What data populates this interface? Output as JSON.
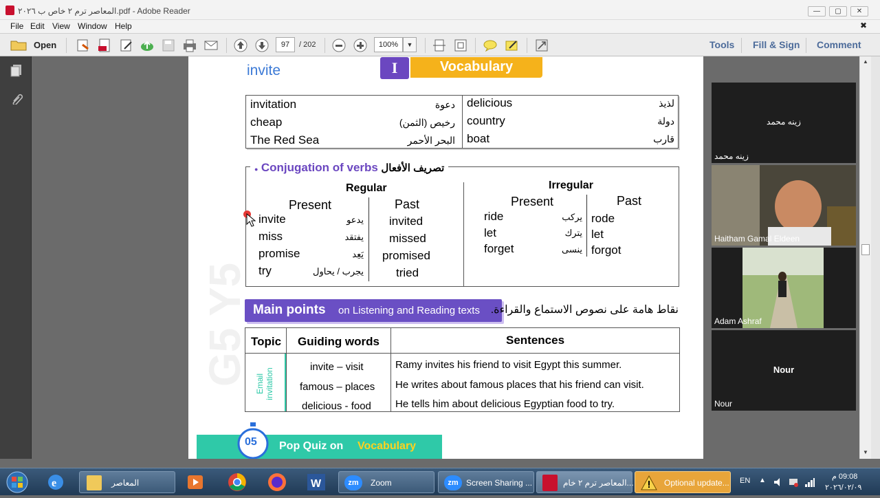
{
  "window": {
    "title": "المعاصر ترم ٢ خاص ب ٢٠٢٦.pdf - Adobe Reader",
    "controls": {
      "minimize": "—",
      "restore": "▢",
      "close": "✕"
    },
    "doc_close": "✖"
  },
  "menu": [
    "File",
    "Edit",
    "View",
    "Window",
    "Help"
  ],
  "toolbar": {
    "open_label": "Open",
    "page_current": "97",
    "page_total": "/ 202",
    "zoom_value": "100%",
    "right_links": [
      "Tools",
      "Fill & Sign",
      "Comment"
    ]
  },
  "document": {
    "header_word": "invite",
    "unit_letter": "I",
    "section_title": "Vocabulary",
    "vocab_left": [
      {
        "en": "invitation",
        "ar": "دعوة"
      },
      {
        "en": "cheap",
        "ar": "رخيص (الثمن)"
      },
      {
        "en": "The Red Sea",
        "ar": "البحر الأحمر"
      }
    ],
    "vocab_right": [
      {
        "en": "delicious",
        "ar": "لذيذ"
      },
      {
        "en": "country",
        "ar": "دولة"
      },
      {
        "en": "boat",
        "ar": "قارب"
      }
    ],
    "conjugation_title": "Conjugation of verbs",
    "conjugation_title_ar": "تصريف الأفعال",
    "regular": {
      "heading": "Regular",
      "col_present": "Present",
      "col_past": "Past",
      "rows": [
        {
          "present": "invite",
          "ar": "يدعو",
          "past": "invited"
        },
        {
          "present": "miss",
          "ar": "يفتقد",
          "past": "missed"
        },
        {
          "present": "promise",
          "ar": "يَعِد",
          "past": "promised"
        },
        {
          "present": "try",
          "ar": "يجرب / يحاول",
          "past": "tried"
        }
      ]
    },
    "irregular": {
      "heading": "Irregular",
      "col_present": "Present",
      "col_past": "Past",
      "rows": [
        {
          "present": "ride",
          "ar": "يركب",
          "past": "rode"
        },
        {
          "present": "let",
          "ar": "يترك",
          "past": "let"
        },
        {
          "present": "forget",
          "ar": "ينسى",
          "past": "forgot"
        }
      ]
    },
    "main_points_bold": "Main points",
    "main_points_rest": "on Listening and Reading texts",
    "main_points_ar": "نقاط هامة على نصوص الاستماع والقراءة.",
    "points_table": {
      "headers": [
        "Topic",
        "Guiding words",
        "Sentences"
      ],
      "topic": "Email invitation",
      "rows": [
        {
          "guide": "invite – visit",
          "sentence": "Ramy invites his friend to visit Egypt this summer."
        },
        {
          "guide": "famous – places",
          "sentence": "He writes about famous places that his friend can visit."
        },
        {
          "guide": "delicious - food",
          "sentence": "He tells him about delicious Egyptian food to try."
        }
      ]
    },
    "watermark": "G5 Y5",
    "quiz_timer": "05",
    "quiz_bold": "Pop Quiz on",
    "quiz_highlight": "Vocabulary"
  },
  "participants": [
    {
      "name": "زينه محمد",
      "center": "زينه محمد",
      "video": false
    },
    {
      "name": "Haitham Gamal Eldeen",
      "center": "",
      "video": true
    },
    {
      "name": "Adam Ashraf",
      "center": "",
      "video": true
    },
    {
      "name": "Nour",
      "center": "Nour",
      "video": false
    }
  ],
  "taskbar": {
    "items": [
      {
        "label": "المعاصر"
      },
      {
        "label": ""
      },
      {
        "label": ""
      },
      {
        "label": ""
      },
      {
        "label": ""
      },
      {
        "label": "Zoom"
      },
      {
        "label": "Screen Sharing ..."
      },
      {
        "label": "المعاصر ترم ٢ خام..."
      },
      {
        "label": "Optional update..."
      }
    ],
    "lang": "EN",
    "time": "09:08 م",
    "date": "٢٠٢٦/٠٢/٠٩"
  },
  "colors": {
    "vocab_banner": "#f5b21b",
    "purple": "#6b47c0",
    "main_points": "#6a4fc4",
    "teal": "#2fc9a8",
    "quiz_yellow": "#ffd21f"
  }
}
